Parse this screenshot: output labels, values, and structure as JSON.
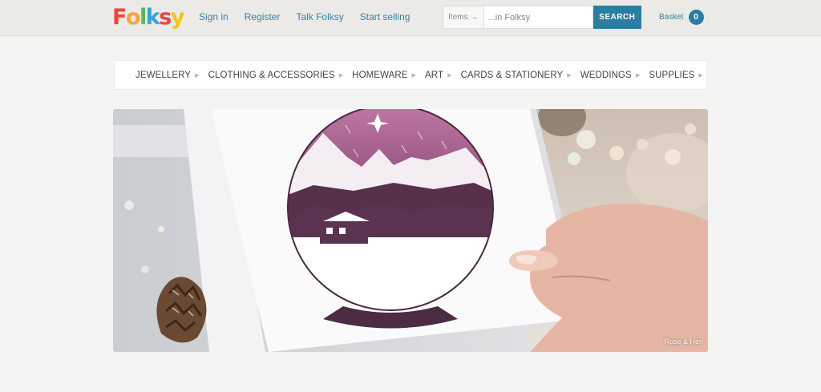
{
  "logo": {
    "letters": [
      "F",
      "o",
      "l",
      "k",
      "s",
      "y"
    ],
    "colors": [
      "#e9463f",
      "#f2a53a",
      "#5cb85c",
      "#3aa0d8",
      "#e9463f",
      "#f5c518"
    ]
  },
  "header": {
    "links": [
      "Sign in",
      "Register",
      "Talk Folksy",
      "Start selling"
    ],
    "search": {
      "scope": "Items →",
      "placeholder": "...in Folksy",
      "button": "SEARCH"
    },
    "basket": {
      "label": "Basket",
      "count": "0"
    }
  },
  "categories": [
    "JEWELLERY",
    "CLOTHING & ACCESSORIES",
    "HOMEWARE",
    "ART",
    "CARDS & STATIONERY",
    "WEDDINGS",
    "SUPPLIES"
  ],
  "icons": {
    "home": "home-icon",
    "category_arrow": "triangle-right-icon"
  },
  "hero": {
    "credit": "Rose & Hen"
  },
  "colors": {
    "link": "#3a7fa8",
    "accent": "#2a7ea1",
    "topbar": "#ebeae7",
    "page": "#f4f4f2"
  }
}
